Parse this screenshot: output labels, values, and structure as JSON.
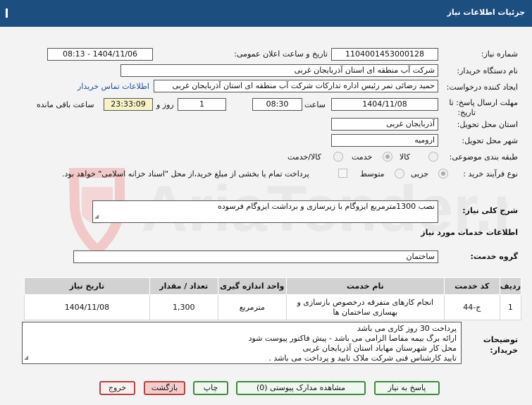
{
  "header": {
    "title": "جزئیات اطلاعات نیاز"
  },
  "need_number": {
    "label": "شماره نیاز:",
    "value": "1104001453000128"
  },
  "announce": {
    "label": "تاریخ و ساعت اعلان عمومی:",
    "value": "1404/11/06 - 08:13"
  },
  "buyer": {
    "label": "نام دستگاه خریدار:",
    "value": "شرکت آب منطقه ای استان آذربایجان غربی"
  },
  "creator": {
    "label": "ایجاد کننده درخواست:",
    "value": "حمید رضائی تمر رئیس اداره تدارکات شرکت آب منطقه ای استان آذربایجان غربی",
    "contact_link": "اطلاعات تماس خریدار"
  },
  "deadline": {
    "label_line1": "مهلت ارسال پاسخ: تا",
    "label_line2": "تاریخ:",
    "date": "1404/11/08",
    "time_label": "ساعت",
    "time": "08:30",
    "days": "1",
    "days_label": "روز و",
    "remaining": "23:33:09",
    "remaining_label": "ساعت باقی مانده"
  },
  "province": {
    "label": "استان محل تحویل:",
    "value": "آذربایجان غربی"
  },
  "city": {
    "label": "شهر محل تحویل:",
    "value": "ارومیه"
  },
  "category": {
    "label": "طبقه بندی موضوعی:",
    "options": [
      "کالا",
      "خدمت",
      "کالا/خدمت"
    ],
    "selected": "خدمت"
  },
  "process": {
    "label": "نوع فرآیند خرید :",
    "options": [
      "جزیی",
      "متوسط"
    ],
    "selected": "جزیی",
    "note": "پرداخت تمام یا بخشی از مبلغ خرید،از محل \"اسناد خزانه اسلامی\" خواهد بود."
  },
  "summary": {
    "label": "شرح کلی نیاز:",
    "value": "نصب 1300مترمربع ایزوگام با زیرسازی و برداشت ایزوگام فرسوده"
  },
  "services_section": {
    "title": "اطلاعات خدمات مورد نیاز"
  },
  "service_group": {
    "label": "گروه خدمت:",
    "value": "ساختمان"
  },
  "table": {
    "headers": [
      "ردیف",
      "کد خدمت",
      "نام خدمت",
      "واحد اندازه گیری",
      "تعداد / مقدار",
      "تاریخ نیاز"
    ],
    "rows": [
      [
        "1",
        "ج-44",
        "انجام کارهای متفرقه درخصوص بازسازی و بهسازی ساختمان ها",
        "مترمربع",
        "1,300",
        "1404/11/08"
      ]
    ]
  },
  "buyer_notes": {
    "label_line1": "توضیحات",
    "label_line2": "خریدار:",
    "lines": [
      "پرداخت 30 روز کاری می باشد",
      "ارائه برگ بیمه مفاصا الزامی می باشد - پیش فاکتور پیوست شود",
      "محل کار شهرستان مهاباد استان آذربایجان غربی",
      "تایید کارشناس فنی شرکت ملاک تایید و پرداخت می باشد ."
    ]
  },
  "buttons": {
    "reply": "پاسخ به نیاز",
    "attachments": "مشاهده مدارک پیوستی (0)",
    "print": "چاپ",
    "back": "بازگشت",
    "exit": "خروج"
  },
  "watermark": {
    "text": "AriaTender.net"
  }
}
